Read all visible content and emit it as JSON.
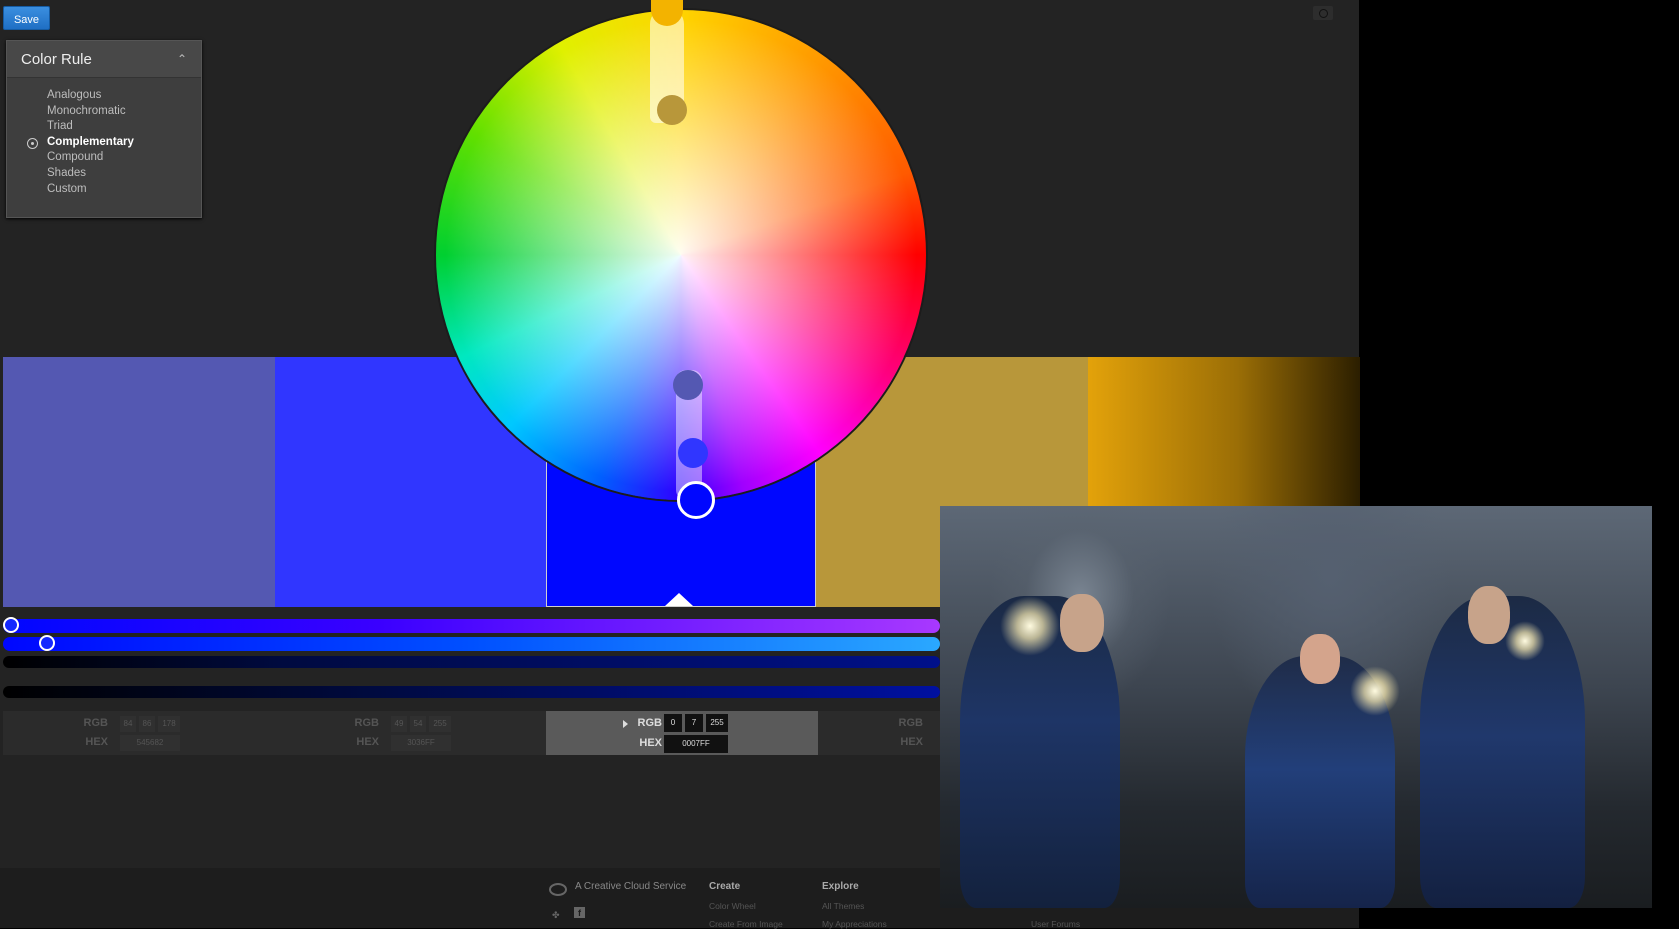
{
  "toolbar": {
    "save_label": "Save"
  },
  "color_rule": {
    "title": "Color Rule",
    "options": [
      "Analogous",
      "Monochromatic",
      "Triad",
      "Complementary",
      "Compound",
      "Shades",
      "Custom"
    ],
    "selected": "Complementary"
  },
  "swatches": [
    {
      "hex": "#5458B2"
    },
    {
      "hex": "#3036FF"
    },
    {
      "hex": "#0007FF",
      "base": true
    },
    {
      "hex": "#B8973A"
    },
    {
      "hex": "#E3A20A"
    }
  ],
  "values": {
    "rgb_label": "RGB",
    "hex_label": "HEX",
    "swatch1": {
      "r": "84",
      "g": "86",
      "b": "178",
      "hex": "545682"
    },
    "swatch2": {
      "r": "49",
      "g": "54",
      "b": "255",
      "hex": "3036FF"
    },
    "swatch3": {
      "r": "0",
      "g": "7",
      "b": "255",
      "hex": "0007FF"
    }
  },
  "footer": {
    "brand": "A Creative Cloud Service",
    "create_heading": "Create",
    "create_links": [
      "Color Wheel",
      "Create From Image"
    ],
    "explore_heading": "Explore",
    "explore_links": [
      "All Themes",
      "My Appreciations"
    ],
    "extra_link": "User Forums"
  },
  "icons": {
    "collapse": "double-chevron-up-icon",
    "camera": "camera-icon",
    "creative_cloud": "creative-cloud-icon",
    "twitter": "twitter-icon",
    "facebook": "facebook-icon"
  },
  "colors": {
    "accent": "#1F6FC4",
    "background": "#232323"
  }
}
